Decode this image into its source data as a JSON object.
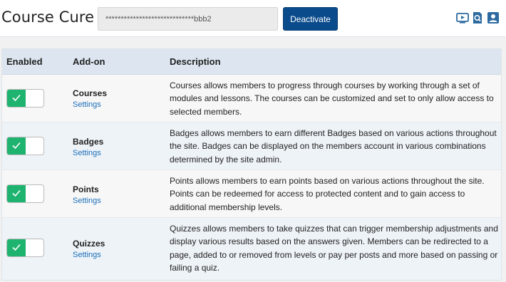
{
  "header": {
    "title": "Course Cure",
    "license_value": "*****************************bbb2",
    "deactivate_label": "Deactivate",
    "icons": [
      "video-icon",
      "search-doc-icon",
      "user-icon"
    ],
    "icon_color": "#2d6aa0"
  },
  "table": {
    "columns": {
      "enabled": "Enabled",
      "addon": "Add-on",
      "description": "Description"
    },
    "settings_label": "Settings",
    "rows": [
      {
        "name": "Courses",
        "enabled": true,
        "description": "Courses allows members to progress through courses by working through a set of modules and lessons. The courses can be customized and set to only allow access to selected members."
      },
      {
        "name": "Badges",
        "enabled": true,
        "description": "Badges allows members to earn different Badges based on various actions throughout the site. Badges can be displayed on the members account in various combinations determined by the site admin."
      },
      {
        "name": "Points",
        "enabled": true,
        "description": "Points allows members to earn points based on various actions throughout the site. Points can be redeemed for access to protected content and to gain access to additional membership levels."
      },
      {
        "name": "Quizzes",
        "enabled": true,
        "description": "Quizzes allows members to take quizzes that can trigger membership adjustments and display various results based on the answers given. Members can be redirected to a page, added to or removed from levels or pay per posts and more based on passing or failing a quiz."
      }
    ]
  },
  "colors": {
    "primary": "#0a4b8c",
    "toggle_on": "#1fb370",
    "link": "#1b6fb8",
    "header_row": "#dde6f0"
  }
}
